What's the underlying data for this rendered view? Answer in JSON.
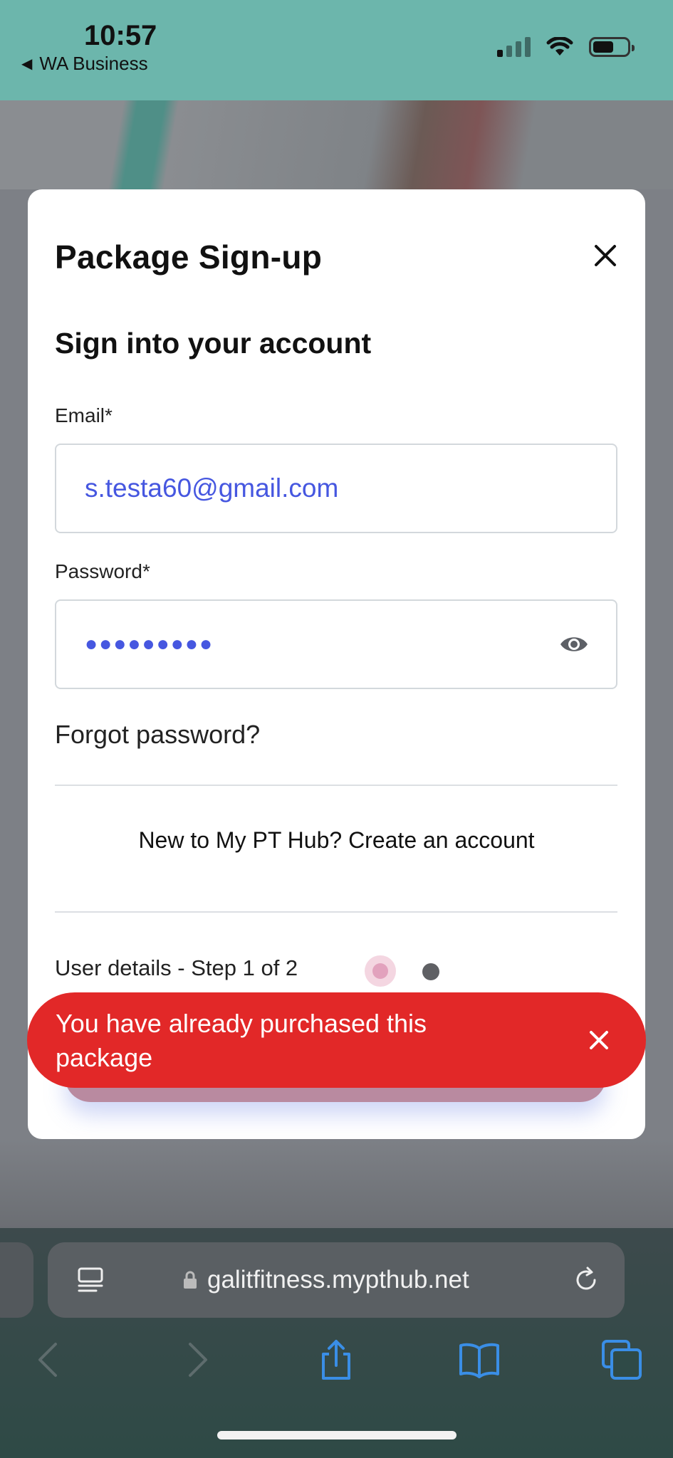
{
  "status_bar": {
    "time": "10:57",
    "back_app": "WA Business"
  },
  "modal": {
    "title": "Package Sign-up",
    "subtitle": "Sign into your account",
    "email": {
      "label": "Email*",
      "value": "s.testa60@gmail.com"
    },
    "password": {
      "label": "Password*",
      "masked_value": "●●●●●●●●●"
    },
    "forgot_password": "Forgot password?",
    "create_account": "New to My PT Hub? Create an account",
    "step_text": "User details - Step 1 of 2",
    "step_current": 1,
    "step_total": 2
  },
  "toast": {
    "message": "You have already purchased this package",
    "color": "#e22828"
  },
  "browser": {
    "url": "galitfitness.mypthub.net"
  },
  "icons": {
    "close": "close-icon",
    "eye": "eye-icon",
    "lock": "lock-icon",
    "reader": "reader-icon",
    "reload": "reload-icon",
    "back": "chevron-left-icon",
    "forward": "chevron-right-icon",
    "share": "share-icon",
    "bookmarks": "book-icon",
    "tabs": "tabs-icon"
  },
  "colors": {
    "status_bar_bg": "#6cb6ac",
    "input_text": "#4657e0",
    "step_active": "#e2a2bd"
  }
}
